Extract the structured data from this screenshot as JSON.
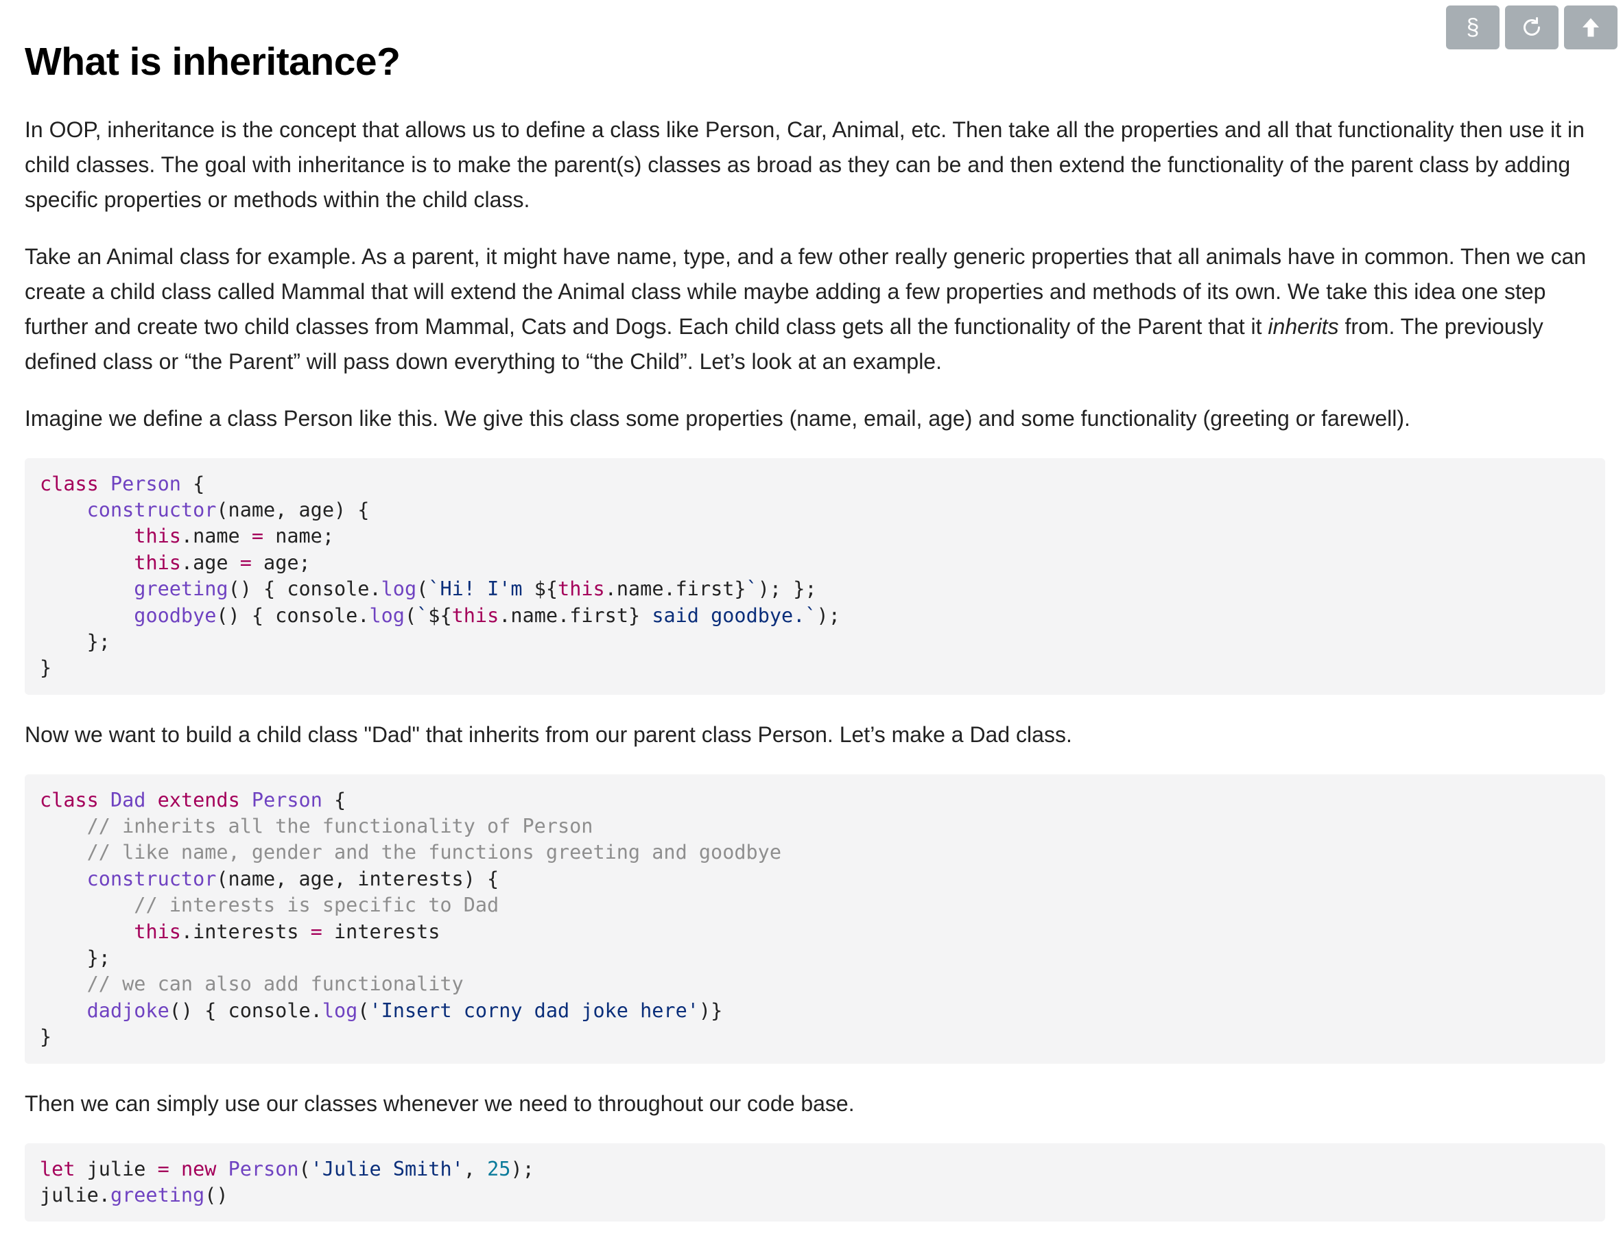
{
  "toolbar": {
    "section_icon_glyph": "§",
    "buttons": [
      "section-icon",
      "refresh-icon",
      "arrow-up-icon"
    ]
  },
  "title": "What is inheritance?",
  "paragraphs": {
    "p1": "In OOP, inheritance is the concept that allows us to define a class like Person, Car, Animal, etc. Then take all the properties and all that functionality then use it in child classes. The goal with inheritance is to make the parent(s) classes as broad as they can be and then extend the functionality of the parent class by adding specific properties or methods within the child class.",
    "p2_before": "Take an Animal class for example. As a parent, it might have name, type, and a few other really generic properties that all animals have in common. Then we can create a child class called Mammal that will extend the Animal class while maybe adding a few properties and methods of its own. We take this idea one step further and create two child classes from Mammal, Cats and Dogs. Each child class gets all the functionality of the Parent that it ",
    "p2_em": "inherits",
    "p2_after": " from. The previously defined class or “the Parent” will pass down everything to “the Child”. Let’s look at an example.",
    "p3": "Imagine we define a class Person like this. We give this class some properties (name, email, age) and some functionality (greeting or farewell).",
    "p4": "Now we want to build a child class \"Dad\" that inherits from our parent class Person. Let’s make a Dad class.",
    "p5": "Then we can simply use our classes whenever we need to throughout our code base."
  },
  "code_blocks": [
    {
      "lines": [
        [
          [
            "kw",
            "class"
          ],
          [
            "",
            " "
          ],
          [
            "cls",
            "Person"
          ],
          [
            "",
            " {"
          ]
        ],
        [
          [
            "",
            "    "
          ],
          [
            "fn",
            "constructor"
          ],
          [
            "",
            "(name, age) {"
          ]
        ],
        [
          [
            "",
            "        "
          ],
          [
            "kw",
            "this"
          ],
          [
            "",
            ".name "
          ],
          [
            "kw",
            "="
          ],
          [
            "",
            " name;"
          ]
        ],
        [
          [
            "",
            "        "
          ],
          [
            "kw",
            "this"
          ],
          [
            "",
            ".age "
          ],
          [
            "kw",
            "="
          ],
          [
            "",
            " age;"
          ]
        ],
        [
          [
            "",
            "        "
          ],
          [
            "fn",
            "greeting"
          ],
          [
            "",
            "() { console."
          ],
          [
            "fn",
            "log"
          ],
          [
            "",
            "("
          ],
          [
            "str",
            "`Hi! I'm "
          ],
          [
            "",
            "${"
          ],
          [
            "kw",
            "this"
          ],
          [
            "",
            ".name.first}"
          ],
          [
            "str",
            "`"
          ],
          [
            "",
            "); };"
          ]
        ],
        [
          [
            "",
            "        "
          ],
          [
            "fn",
            "goodbye"
          ],
          [
            "",
            "() { console."
          ],
          [
            "fn",
            "log"
          ],
          [
            "",
            "("
          ],
          [
            "str",
            "`"
          ],
          [
            "",
            "${"
          ],
          [
            "kw",
            "this"
          ],
          [
            "",
            ".name.first} "
          ],
          [
            "str",
            "said goodbye.`"
          ],
          [
            "",
            ");"
          ]
        ],
        [
          [
            "",
            "    };"
          ]
        ],
        [
          [
            "",
            "}"
          ]
        ]
      ]
    },
    {
      "lines": [
        [
          [
            "kw",
            "class"
          ],
          [
            "",
            " "
          ],
          [
            "cls",
            "Dad"
          ],
          [
            "",
            " "
          ],
          [
            "kw",
            "extends"
          ],
          [
            "",
            " "
          ],
          [
            "cls",
            "Person"
          ],
          [
            "",
            " {"
          ]
        ],
        [
          [
            "",
            "    "
          ],
          [
            "cm",
            "// inherits all the functionality of Person"
          ]
        ],
        [
          [
            "",
            "    "
          ],
          [
            "cm",
            "// like name, gender and the functions greeting and goodbye"
          ]
        ],
        [
          [
            "",
            "    "
          ],
          [
            "fn",
            "constructor"
          ],
          [
            "",
            "(name, age, interests) {"
          ]
        ],
        [
          [
            "",
            "        "
          ],
          [
            "cm",
            "// interests is specific to Dad"
          ]
        ],
        [
          [
            "",
            "        "
          ],
          [
            "kw",
            "this"
          ],
          [
            "",
            ".interests "
          ],
          [
            "kw",
            "="
          ],
          [
            "",
            " interests"
          ]
        ],
        [
          [
            "",
            "    };"
          ]
        ],
        [
          [
            "",
            "    "
          ],
          [
            "cm",
            "// we can also add functionality"
          ]
        ],
        [
          [
            "",
            "    "
          ],
          [
            "fn",
            "dadjoke"
          ],
          [
            "",
            "() { console."
          ],
          [
            "fn",
            "log"
          ],
          [
            "",
            "("
          ],
          [
            "str",
            "'Insert corny dad joke here'"
          ],
          [
            "",
            ")}"
          ]
        ],
        [
          [
            "",
            "}"
          ]
        ]
      ]
    },
    {
      "lines": [
        [
          [
            "kw",
            "let"
          ],
          [
            "",
            " julie "
          ],
          [
            "kw",
            "="
          ],
          [
            "",
            " "
          ],
          [
            "kw",
            "new"
          ],
          [
            "",
            " "
          ],
          [
            "cls",
            "Person"
          ],
          [
            "",
            "("
          ],
          [
            "str",
            "'Julie Smith'"
          ],
          [
            "",
            ", "
          ],
          [
            "num",
            "25"
          ],
          [
            "",
            ");"
          ]
        ],
        [
          [
            "",
            "julie."
          ],
          [
            "fn",
            "greeting"
          ],
          [
            "",
            "()"
          ]
        ]
      ]
    }
  ]
}
